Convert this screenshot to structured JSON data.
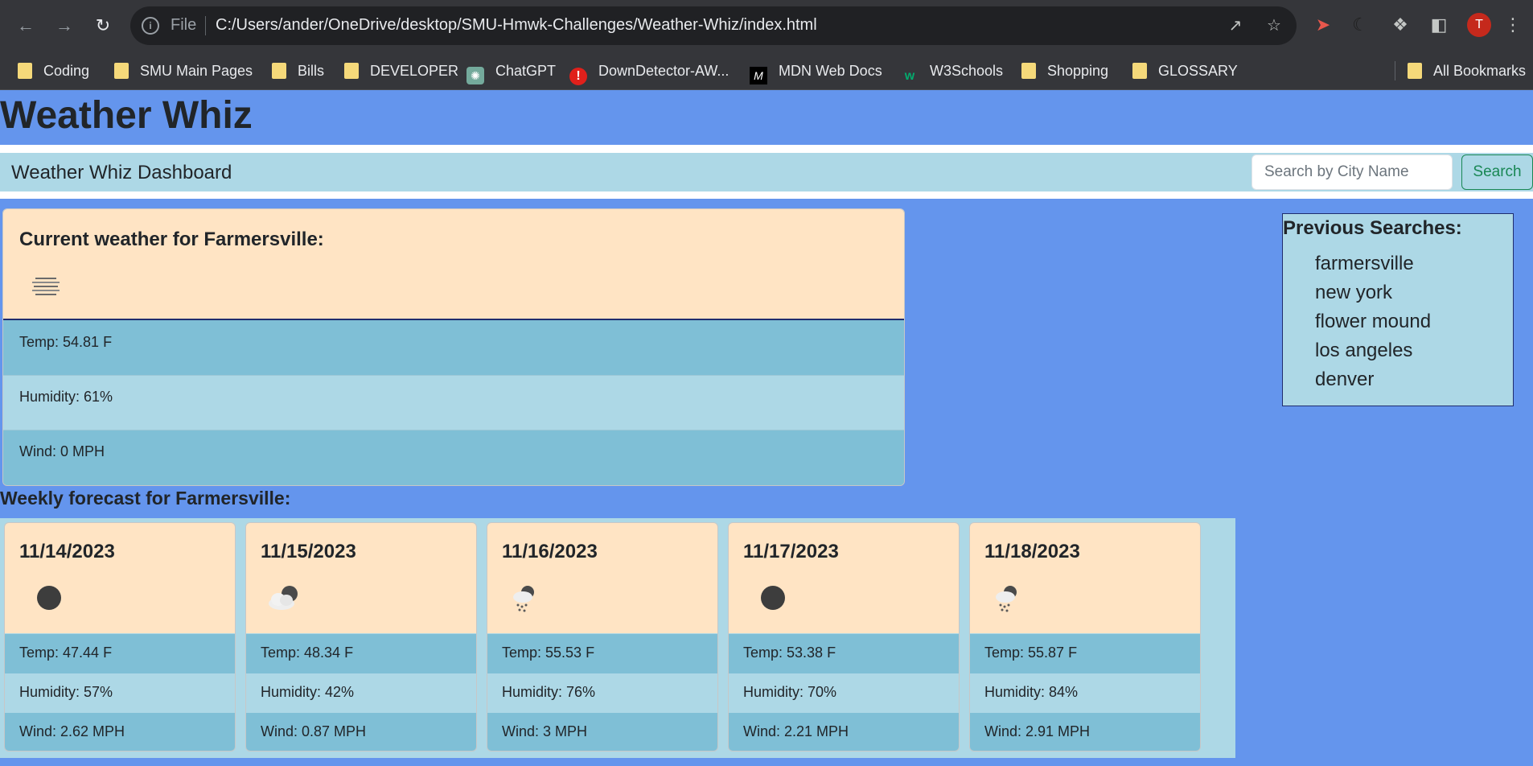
{
  "browser": {
    "file_label": "File",
    "url": "C:/Users/ander/OneDrive/desktop/SMU-Hmwk-Challenges/Weather-Whiz/index.html",
    "avatar_letter": "T",
    "bookmarks": [
      {
        "label": "Coding",
        "icon": "folder-icon"
      },
      {
        "label": "SMU Main Pages",
        "icon": "folder-icon"
      },
      {
        "label": "Bills",
        "icon": "folder-icon"
      },
      {
        "label": "DEVELOPER",
        "icon": "folder-icon"
      },
      {
        "label": "ChatGPT",
        "icon": "chatgpt-icon"
      },
      {
        "label": "DownDetector-AW...",
        "icon": "downdetector-icon"
      },
      {
        "label": "MDN Web Docs",
        "icon": "mdn-icon"
      },
      {
        "label": "W3Schools",
        "icon": "w3schools-icon"
      },
      {
        "label": "Shopping",
        "icon": "folder-icon"
      },
      {
        "label": "GLOSSARY",
        "icon": "folder-icon"
      },
      {
        "label": "All Bookmarks",
        "icon": "folder-icon"
      }
    ]
  },
  "page": {
    "title": "Weather Whiz",
    "brand": "Weather Whiz Dashboard",
    "search": {
      "placeholder": "Search by City Name",
      "button_label": "Search"
    }
  },
  "current": {
    "heading": "Current weather for Farmersville:",
    "icon": "mist-icon",
    "temp": "Temp: 54.81 F",
    "humidity": "Humidity: 61%",
    "wind": "Wind: 0 MPH"
  },
  "previous": {
    "heading": "Previous Searches:",
    "items": [
      "farmersville",
      "new york",
      "flower mound",
      "los angeles",
      "denver"
    ]
  },
  "forecast": {
    "heading": "Weekly forecast for Farmersville:",
    "days": [
      {
        "date": "11/14/2023",
        "icon": "dark-circle-icon",
        "temp": "Temp: 47.44 F",
        "humidity": "Humidity: 57%",
        "wind": "Wind: 2.62 MPH"
      },
      {
        "date": "11/15/2023",
        "icon": "partly-cloudy-icon",
        "temp": "Temp: 48.34 F",
        "humidity": "Humidity: 42%",
        "wind": "Wind: 0.87 MPH"
      },
      {
        "date": "11/16/2023",
        "icon": "rain-cloud-icon",
        "temp": "Temp: 55.53 F",
        "humidity": "Humidity: 76%",
        "wind": "Wind: 3 MPH"
      },
      {
        "date": "11/17/2023",
        "icon": "dark-circle-icon",
        "temp": "Temp: 53.38 F",
        "humidity": "Humidity: 70%",
        "wind": "Wind: 2.21 MPH"
      },
      {
        "date": "11/18/2023",
        "icon": "rain-cloud-icon",
        "temp": "Temp: 55.87 F",
        "humidity": "Humidity: 84%",
        "wind": "Wind: 2.91 MPH"
      }
    ]
  }
}
